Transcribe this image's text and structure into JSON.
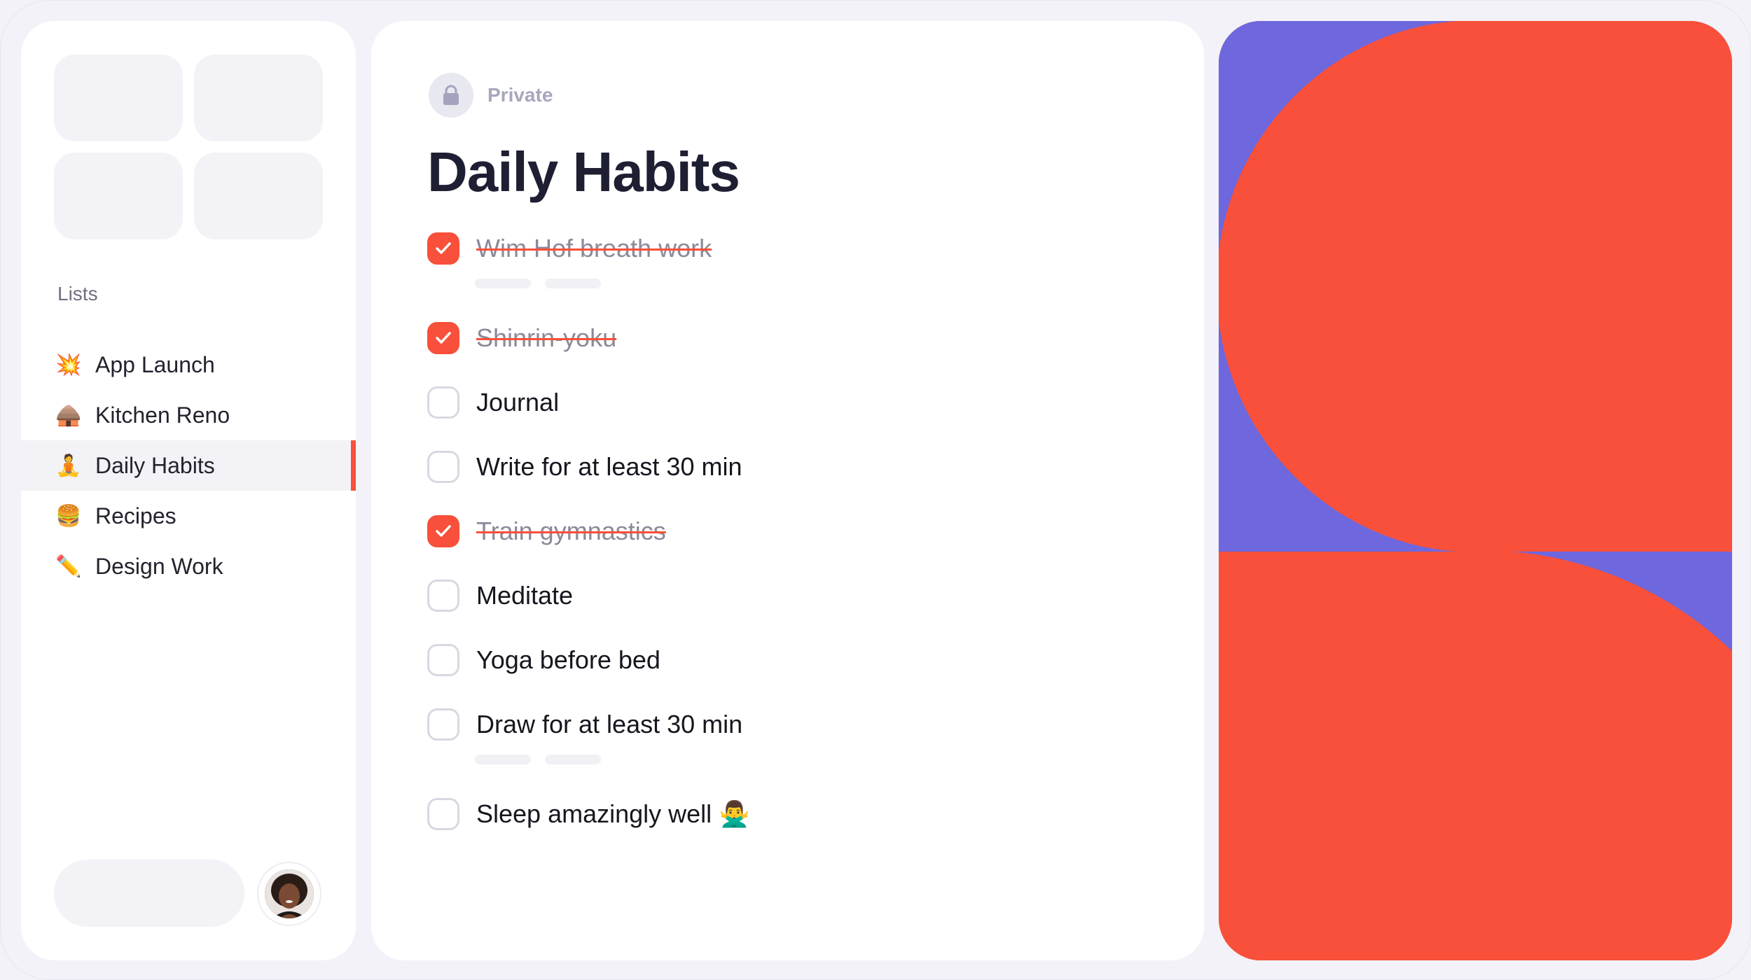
{
  "sidebar": {
    "lists_heading": "Lists",
    "items": [
      {
        "emoji": "💥",
        "label": "App Launch",
        "active": false
      },
      {
        "emoji": "🛖",
        "label": "Kitchen Reno",
        "active": false
      },
      {
        "emoji": "🧘",
        "label": "Daily Habits",
        "active": true
      },
      {
        "emoji": "🍔",
        "label": "Recipes",
        "active": false
      },
      {
        "emoji": "✏️",
        "label": "Design Work",
        "active": false
      }
    ]
  },
  "main": {
    "privacy_label": "Private",
    "title": "Daily Habits",
    "tasks": [
      {
        "label": "Wim Hof breath work",
        "done": true
      },
      {
        "label": "Shinrin-yoku",
        "done": true
      },
      {
        "label": "Journal",
        "done": false
      },
      {
        "label": "Write for at least 30 min",
        "done": false
      },
      {
        "label": "Train gymnastics",
        "done": true
      },
      {
        "label": "Meditate",
        "done": false
      },
      {
        "label": "Yoga before bed",
        "done": false
      },
      {
        "label": "Draw for at least 30 min",
        "done": false
      },
      {
        "label": "Sleep amazingly well 🙅‍♂️",
        "done": false
      }
    ]
  },
  "colors": {
    "accent": "#f8503a",
    "art_purple": "#6e67dd",
    "art_red": "#f8503a"
  },
  "icons": {
    "privacy": "lock-icon",
    "check": "checkmark-icon"
  }
}
